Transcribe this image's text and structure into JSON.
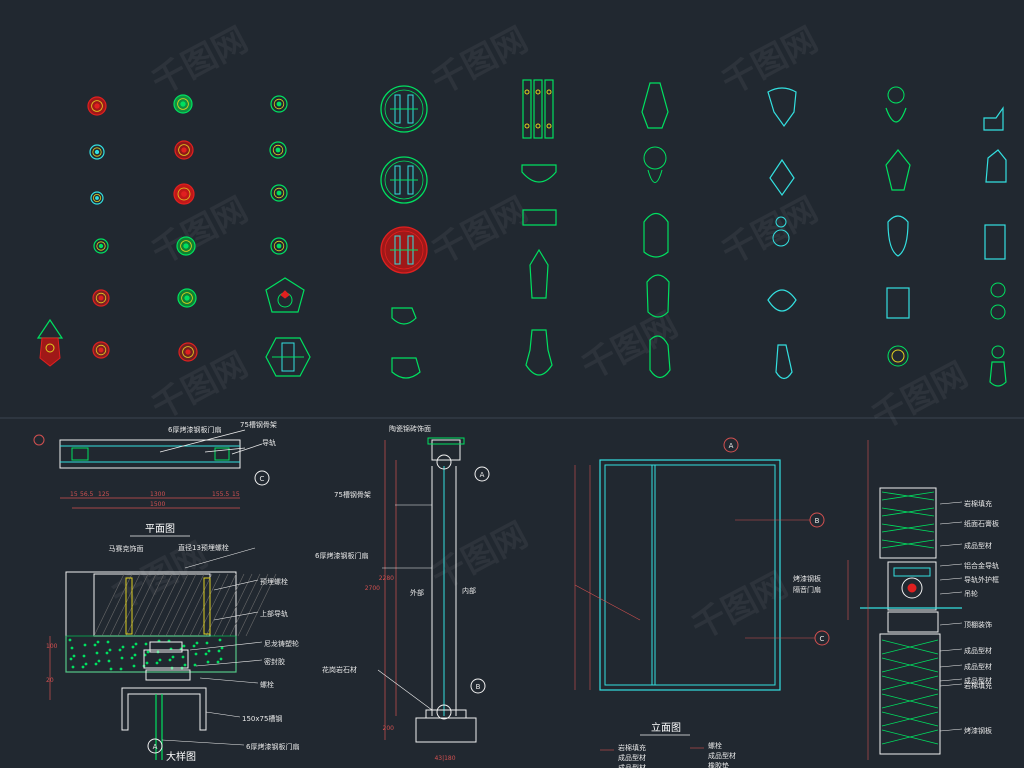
{
  "colors": {
    "background": "#212830",
    "green": "#00e060",
    "cyan": "#33e0e0",
    "red": "#e02020",
    "yellow": "#e0d020",
    "white": "#f0f0f0",
    "dimension": "#d25050"
  },
  "watermark": "千图网",
  "plan": {
    "title": "平面图",
    "labels": [
      "6厚烤漆钢板门扇",
      "75槽钢骨架",
      "导轨"
    ],
    "dims": [
      "15",
      "56.5",
      "125",
      "1300",
      "155.5",
      "15",
      "1500"
    ],
    "section_mark": "C"
  },
  "detail": {
    "title": "大样图",
    "mark": "A",
    "labels": [
      "马赛克饰面",
      "直径13预埋螺栓",
      "预埋螺栓",
      "上部导轨",
      "尼龙铸塑轮",
      "密封胶",
      "螺栓",
      "150x75槽钢",
      "6厚烤漆钢板门扇"
    ],
    "dims": [
      "100",
      "20"
    ]
  },
  "section": {
    "labels": [
      "陶瓷锦砖饰面",
      "75槽钢骨架",
      "6厚烤漆钢板门扇",
      "外部",
      "内部",
      "花岗岩石材"
    ],
    "dims": [
      "2700",
      "2280",
      "200",
      "75",
      "75"
    ],
    "marks": [
      "A",
      "B"
    ],
    "bottom_dim": "43|180"
  },
  "elevation": {
    "title": "立面图",
    "labels": [
      "烤漆钢板",
      "隔音门扇"
    ],
    "marks": [
      "A",
      "B",
      "C"
    ],
    "bottom_labels": [
      "岩棉填充",
      "成品型材",
      "成品型材",
      "螺栓",
      "成品型材",
      "橡胶垫"
    ]
  },
  "wall_detail": {
    "labels": [
      "岩棉填充",
      "纸面石膏板",
      "成品型材",
      "铝合金导轨",
      "导轨外护框",
      "吊轮",
      "顶棚装饰",
      "成品型材",
      "成品型材",
      "成品型材",
      "岩棉填充",
      "烤漆钢板"
    ]
  },
  "hardware_icons": [
    "door-knob-icon",
    "door-knocker-icon",
    "ring-pull-icon",
    "lotus-handle-icon",
    "gourd-pull-icon",
    "escutcheon-icon",
    "plate-handle-icon",
    "round-plate-icon",
    "lock-plate-icon",
    "drop-pull-icon"
  ]
}
